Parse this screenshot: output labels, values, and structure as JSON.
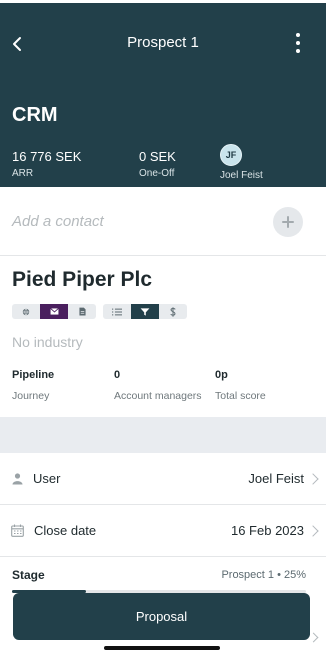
{
  "header": {
    "title": "Prospect 1",
    "section": "CRM",
    "stats": [
      {
        "value": "16 776 SEK",
        "label": "ARR"
      },
      {
        "value": "0 SEK",
        "label": "One-Off"
      }
    ],
    "owner": {
      "initials": "JF",
      "name": "Joel Feist"
    }
  },
  "contact": {
    "placeholder": "Add a contact",
    "add_icon": "plus-icon"
  },
  "company": {
    "name": "Pied Piper Plc",
    "tabs_left": [
      "globe-icon",
      "mail-icon",
      "document-icon"
    ],
    "tabs_right": [
      "list-icon",
      "funnel-icon",
      "dollar-icon"
    ],
    "industry": "No industry",
    "metrics": [
      {
        "value": "Pipeline",
        "label": "Journey"
      },
      {
        "value": "0",
        "label": "Account managers"
      },
      {
        "value": "0p",
        "label": "Total score"
      }
    ]
  },
  "fields": {
    "user": {
      "label": "User",
      "value": "Joel Feist"
    },
    "close_date": {
      "label": "Close date",
      "value": "16 Feb 2023"
    }
  },
  "stage": {
    "label": "Stage",
    "value": "Prospect 1 • 25%",
    "progress": 0.25,
    "button": "Proposal"
  },
  "colors": {
    "primary": "#22404a",
    "accent_purple": "#4a1f5e",
    "band": "#e9ecf0"
  }
}
